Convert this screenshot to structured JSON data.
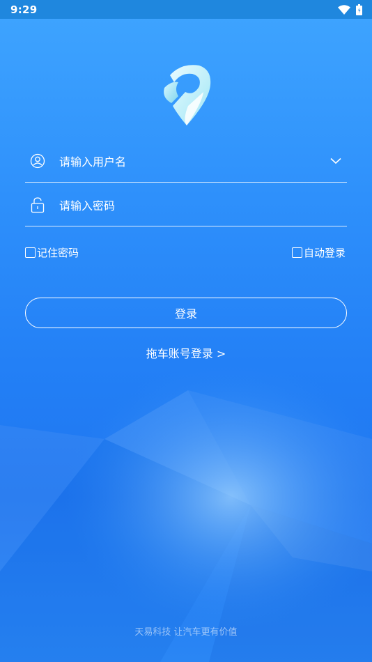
{
  "status_bar": {
    "time": "9:29"
  },
  "form": {
    "username_placeholder": "请输入用户名",
    "password_placeholder": "请输入密码"
  },
  "options": {
    "remember_password": "记住密码",
    "auto_login": "自动登录"
  },
  "actions": {
    "login_label": "登录",
    "tow_login_link": "拖车账号登录 >"
  },
  "footer": {
    "slogan": "天易科技 让汽车更有价值"
  },
  "colors": {
    "background": "#2e90fb",
    "status_bar": "#1f87de",
    "text": "#ffffff"
  },
  "icons": [
    "wifi-icon",
    "battery-icon",
    "app-logo-icon",
    "user-icon",
    "chevron-down-icon",
    "lock-icon"
  ]
}
